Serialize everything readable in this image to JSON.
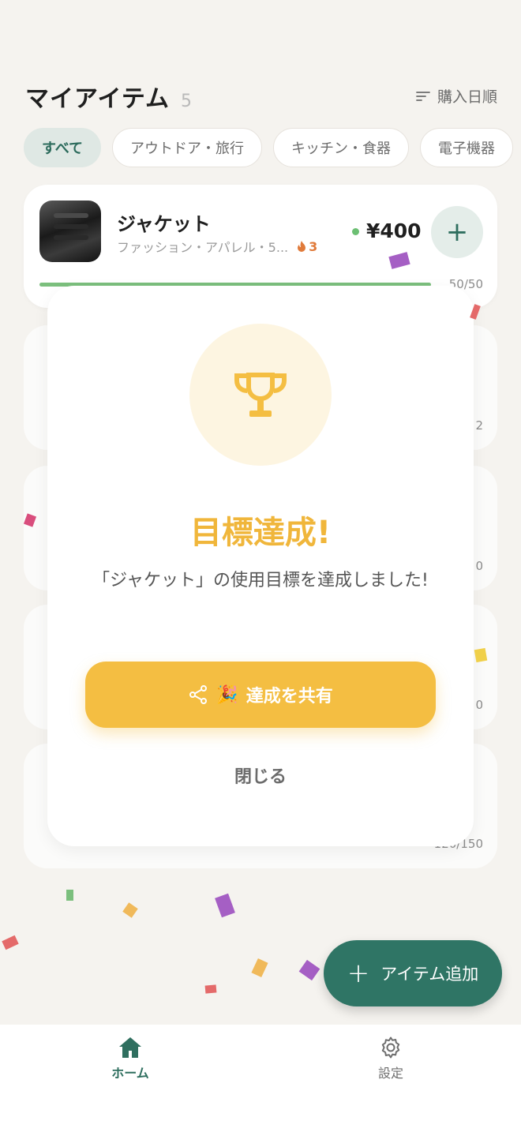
{
  "header": {
    "title": "マイアイテム",
    "count": "5",
    "sort_label": "購入日順"
  },
  "filters": [
    {
      "label": "すべて",
      "active": true
    },
    {
      "label": "アウトドア・旅行",
      "active": false
    },
    {
      "label": "キッチン・食器",
      "active": false
    },
    {
      "label": "電子機器",
      "active": false
    }
  ],
  "item": {
    "name": "ジャケット",
    "meta": "ファッション・アパレル・5...",
    "streak": "3",
    "price": "¥400",
    "progress_label": "50/50",
    "progress": 1.0
  },
  "ghost_labels": [
    "2",
    "0",
    "0",
    "120/150"
  ],
  "modal": {
    "title": "目標達成!",
    "message": "「ジャケット」の使用目標を達成しました!",
    "share_label": "達成を共有",
    "share_emoji": "🎉",
    "close_label": "閉じる"
  },
  "fab": {
    "label": "アイテム追加"
  },
  "nav": {
    "home": "ホーム",
    "settings": "設定"
  },
  "colors": {
    "accent": "#2f7565",
    "gold": "#f4be42",
    "progress": "#7bbf7d"
  }
}
